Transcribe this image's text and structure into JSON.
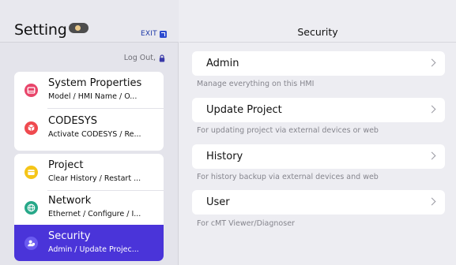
{
  "sidebar": {
    "title": "Setting",
    "exit_label": "EXIT",
    "logout_label": "Log Out,",
    "groups": [
      {
        "items": [
          {
            "title": "System Properties",
            "subtitle": "Model / HMI Name / O...",
            "icon": "system-properties-icon",
            "color": "#e8456a",
            "selected": false
          },
          {
            "title": "CODESYS",
            "subtitle": "Activate CODESYS / Re...",
            "icon": "codesys-cube-icon",
            "color": "#ef4a4f",
            "selected": false
          }
        ]
      },
      {
        "items": [
          {
            "title": "Project",
            "subtitle": "Clear History / Restart ...",
            "icon": "project-icon",
            "color": "#f5c518",
            "selected": false
          },
          {
            "title": "Network",
            "subtitle": "Ethernet / Configure / I...",
            "icon": "globe-icon",
            "color": "#27a889",
            "selected": false
          },
          {
            "title": "Security",
            "subtitle": "Admin / Update Projec...",
            "icon": "user-shield-icon",
            "color": "#6b5bf0",
            "selected": true
          }
        ]
      }
    ]
  },
  "main": {
    "title": "Security",
    "rows": [
      {
        "label": "Admin",
        "description": "Manage everything on this HMI"
      },
      {
        "label": "Update Project",
        "description": "For updating project via external devices or web"
      },
      {
        "label": "History",
        "description": "For history backup via external devices and web"
      },
      {
        "label": "User",
        "description": "For cMT Viewer/Diagnoser"
      }
    ]
  },
  "colors": {
    "accent": "#4a34d9",
    "exit": "#2c4bd0"
  }
}
